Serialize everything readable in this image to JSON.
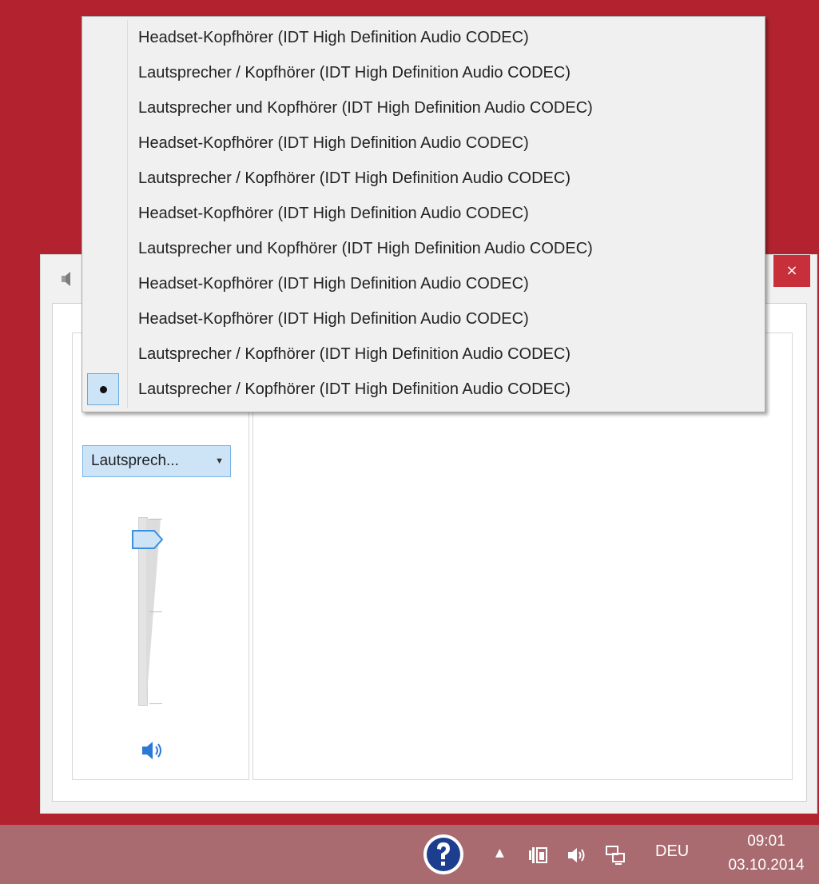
{
  "window": {
    "close_label": "×",
    "selected_device_short": "Lautsprech...",
    "accent_color": "#b3232f"
  },
  "device_menu": {
    "items": [
      {
        "label": "Headset-Kopfhörer (IDT High Definition Audio CODEC)",
        "selected": false
      },
      {
        "label": "Lautsprecher / Kopfhörer (IDT High Definition Audio CODEC)",
        "selected": false
      },
      {
        "label": "Lautsprecher und Kopfhörer (IDT High Definition Audio CODEC)",
        "selected": false
      },
      {
        "label": "Headset-Kopfhörer (IDT High Definition Audio CODEC)",
        "selected": false
      },
      {
        "label": "Lautsprecher / Kopfhörer (IDT High Definition Audio CODEC)",
        "selected": false
      },
      {
        "label": "Headset-Kopfhörer (IDT High Definition Audio CODEC)",
        "selected": false
      },
      {
        "label": "Lautsprecher und Kopfhörer (IDT High Definition Audio CODEC)",
        "selected": false
      },
      {
        "label": "Headset-Kopfhörer (IDT High Definition Audio CODEC)",
        "selected": false
      },
      {
        "label": "Headset-Kopfhörer (IDT High Definition Audio CODEC)",
        "selected": false
      },
      {
        "label": "Lautsprecher / Kopfhörer (IDT High Definition Audio CODEC)",
        "selected": false
      },
      {
        "label": "Lautsprecher / Kopfhörer (IDT High Definition Audio CODEC)",
        "selected": true
      }
    ]
  },
  "volume": {
    "level_fraction": 0.88,
    "icon": "speaker-icon"
  },
  "taskbar": {
    "language": "DEU",
    "time": "09:01",
    "date": "03.10.2014",
    "tray_icons": [
      "help-icon",
      "show-hidden-icons-arrow",
      "power-icon",
      "volume-icon",
      "network-icon"
    ]
  }
}
